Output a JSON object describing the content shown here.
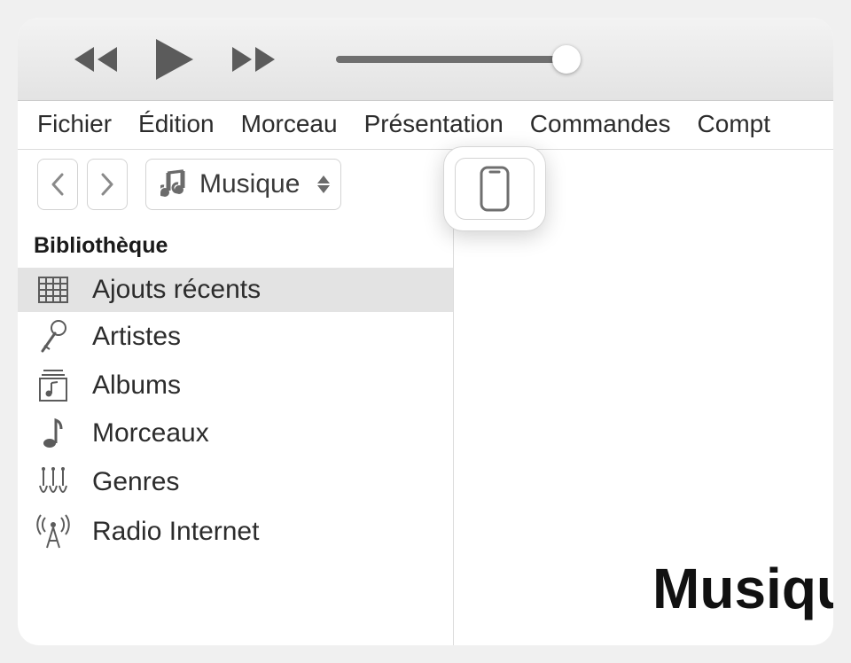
{
  "menubar": {
    "file": "Fichier",
    "edit": "Édition",
    "song": "Morceau",
    "view": "Présentation",
    "controls": "Commandes",
    "account": "Compt"
  },
  "category": {
    "label": "Musique"
  },
  "sidebar": {
    "heading": "Bibliothèque",
    "items": [
      {
        "label": "Ajouts récents"
      },
      {
        "label": "Artistes"
      },
      {
        "label": "Albums"
      },
      {
        "label": "Morceaux"
      },
      {
        "label": "Genres"
      },
      {
        "label": "Radio Internet"
      }
    ]
  },
  "main": {
    "title": "Musiqu"
  }
}
